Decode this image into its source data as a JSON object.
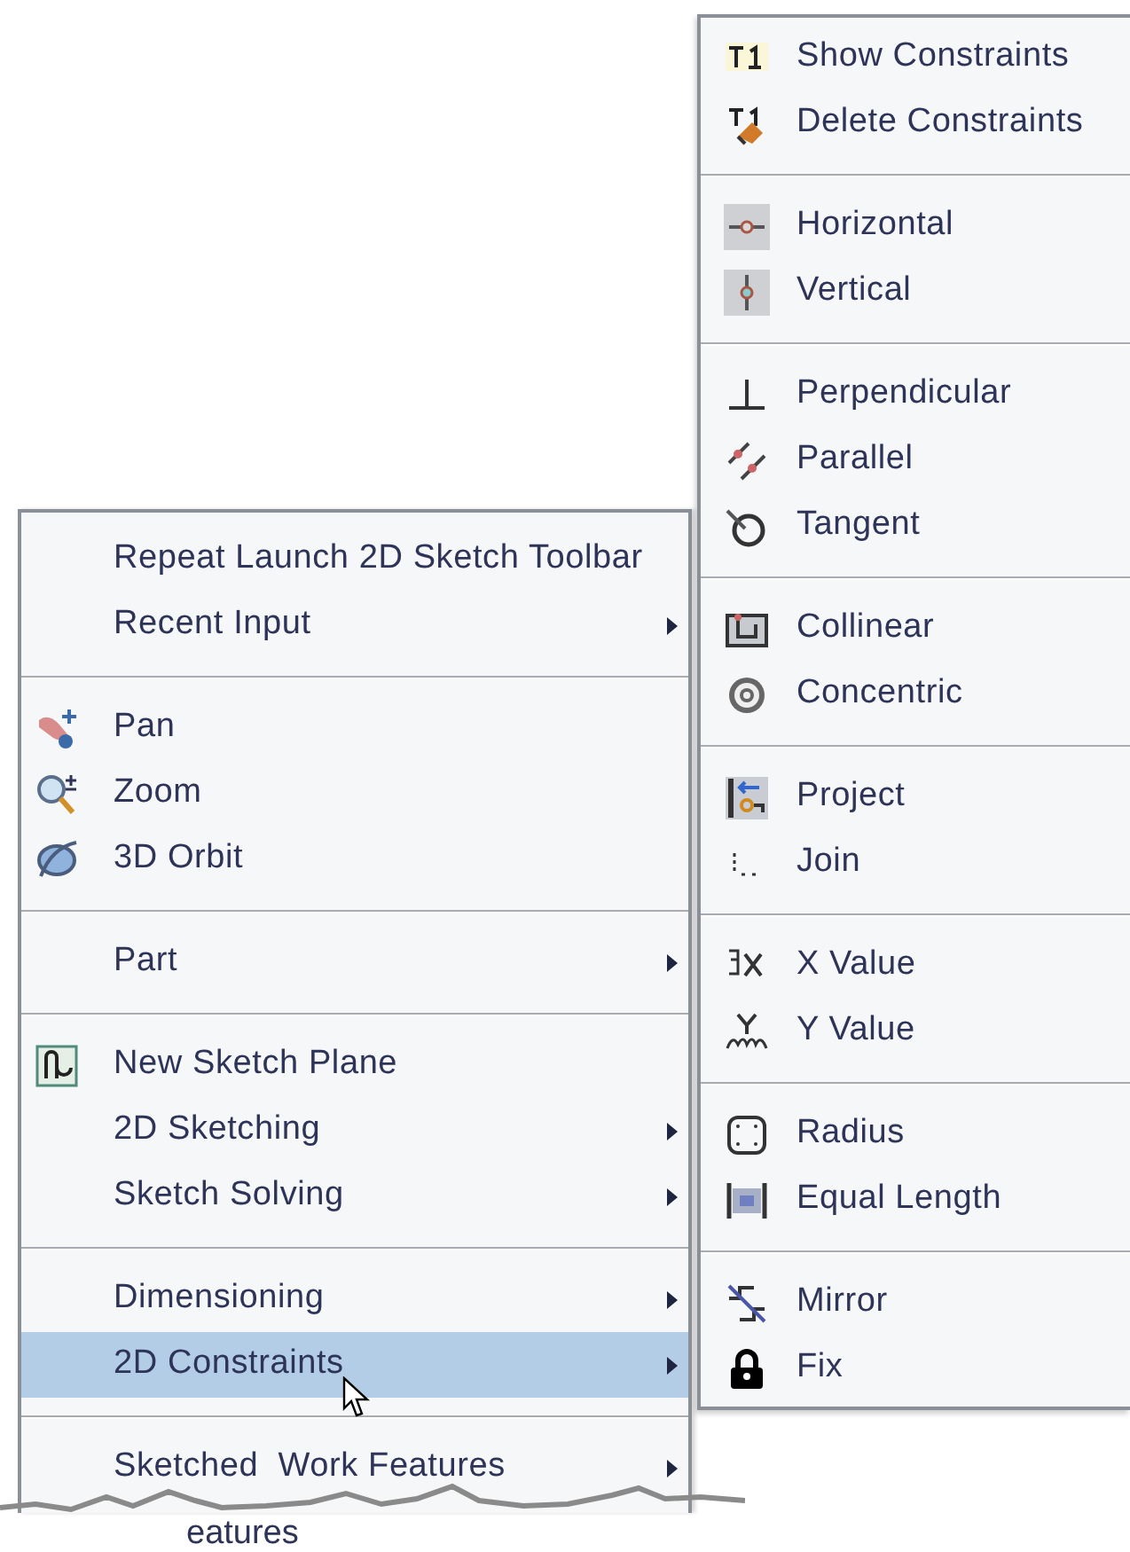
{
  "context_menu": {
    "groups": [
      {
        "items": [
          {
            "label": "Repeat Launch 2D Sketch Toolbar",
            "submenu": false,
            "selected": false
          },
          {
            "label": "Recent Input",
            "submenu": true,
            "selected": false
          }
        ]
      },
      {
        "items": [
          {
            "label": "Pan",
            "submenu": false,
            "selected": false
          },
          {
            "label": "Zoom",
            "submenu": false,
            "selected": false
          },
          {
            "label": "3D Orbit",
            "submenu": false,
            "selected": false
          }
        ]
      },
      {
        "items": [
          {
            "label": "Part",
            "submenu": true,
            "selected": false
          }
        ]
      },
      {
        "items": [
          {
            "label": "New Sketch Plane",
            "submenu": false,
            "selected": false
          },
          {
            "label": "2D Sketching",
            "submenu": true,
            "selected": false
          },
          {
            "label": "Sketch Solving",
            "submenu": true,
            "selected": false
          }
        ]
      },
      {
        "items": [
          {
            "label": "Dimensioning",
            "submenu": true,
            "selected": false
          },
          {
            "label": "2D Constraints",
            "submenu": true,
            "selected": true
          }
        ]
      },
      {
        "items": [
          {
            "label": "Sketched  Work Features",
            "submenu": true,
            "selected": false
          }
        ]
      }
    ],
    "cut_text": "eatures"
  },
  "submenu": {
    "groups": [
      {
        "items": [
          {
            "label": "Show Constraints"
          },
          {
            "label": "Delete Constraints"
          }
        ]
      },
      {
        "items": [
          {
            "label": "Horizontal"
          },
          {
            "label": "Vertical"
          }
        ]
      },
      {
        "items": [
          {
            "label": "Perpendicular"
          },
          {
            "label": "Parallel"
          },
          {
            "label": "Tangent"
          }
        ]
      },
      {
        "items": [
          {
            "label": "Collinear"
          },
          {
            "label": "Concentric"
          }
        ]
      },
      {
        "items": [
          {
            "label": "Project"
          },
          {
            "label": "Join"
          }
        ]
      },
      {
        "items": [
          {
            "label": "X Value"
          },
          {
            "label": "Y Value"
          }
        ]
      },
      {
        "items": [
          {
            "label": "Radius"
          },
          {
            "label": "Equal Length"
          }
        ]
      },
      {
        "items": [
          {
            "label": "Mirror"
          },
          {
            "label": "Fix"
          }
        ]
      }
    ]
  }
}
